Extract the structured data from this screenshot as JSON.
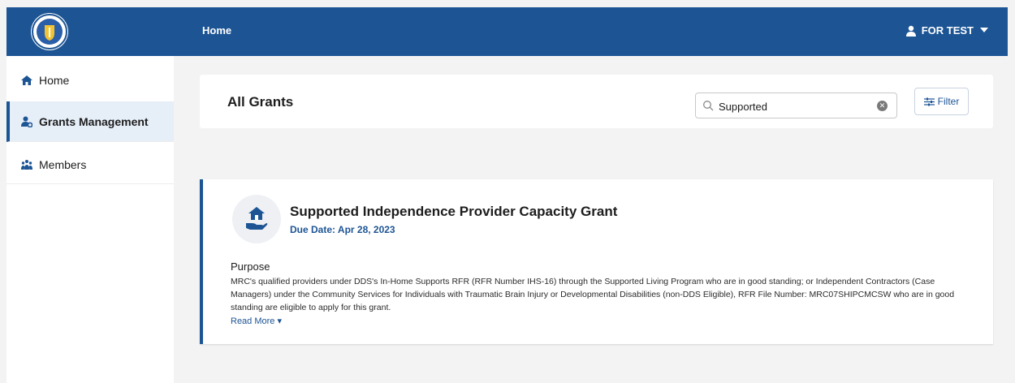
{
  "header": {
    "breadcrumb": "Home",
    "user_name": "FOR TEST",
    "seal_icon": "massachusetts-seal-icon"
  },
  "sidebar": {
    "items": [
      {
        "label": "Home",
        "icon": "home-icon",
        "active": false
      },
      {
        "label": "Grants Management",
        "icon": "user-gear-icon",
        "active": true
      },
      {
        "label": "Members",
        "icon": "people-icon",
        "active": false
      }
    ]
  },
  "list_header": {
    "title": "All Grants",
    "search_value": "Supported",
    "filter_label": "Filter"
  },
  "grant": {
    "title": "Supported Independence Provider Capacity Grant",
    "due_date": "Due Date: Apr 28, 2023",
    "purpose_heading": "Purpose",
    "purpose_text": "MRC's qualified providers under DDS's In-Home Supports RFR (RFR Number IHS-16) through the Supported Living Program who are in good standing; or Independent Contractors (Case Managers) under the Community Services for Individuals with Traumatic Brain Injury or Developmental Disabilities (non-DDS Eligible), RFR File Number: MRC07SHIPCMCSW who are in good standing are eligible to apply for this grant.",
    "read_more": "Read More"
  },
  "colors": {
    "brand_blue": "#1c5494",
    "active_nav_bg": "#e6eef8",
    "page_bg": "#f3f3f3"
  }
}
